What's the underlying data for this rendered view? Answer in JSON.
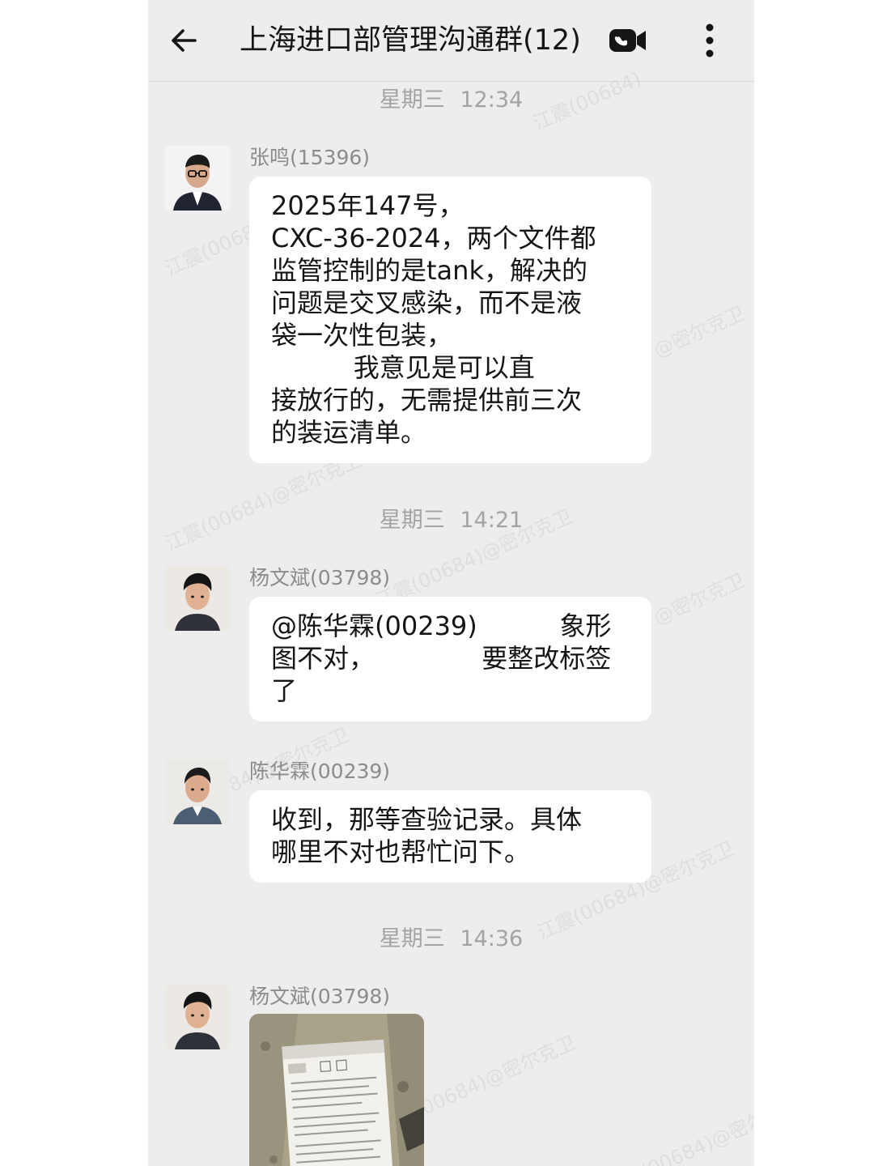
{
  "header": {
    "title": "上海进口部管理沟通群(12)",
    "back_icon": "arrow-left-icon",
    "video_icon": "video-call-icon",
    "more_icon": "more-vertical-icon"
  },
  "chat": {
    "time_1": "星期三 12:34",
    "time_2": "星期三 14:21",
    "time_3": "星期三 14:36",
    "messages": [
      {
        "sender": "张鸣(15396)",
        "lines": [
          "2025年147号，",
          "CXC-36-2024，两个文件都",
          "监管控制的是tank，解决的",
          "问题是交叉感染，而不是液",
          "袋一次性包装，",
          "          我意见是可以直",
          "接放行的，无需提供前三次",
          "的装运清单。"
        ]
      },
      {
        "sender": "杨文斌(03798)",
        "lines": [
          "@陈华霖(00239)          象形",
          "图不对，             要整改标签",
          "了"
        ]
      },
      {
        "sender": "陈华霖(00239)",
        "lines": [
          "收到，那等查验记录。具体",
          "哪里不对也帮忙问下。"
        ]
      },
      {
        "sender": "杨文斌(03798)",
        "image": "label-photo"
      }
    ]
  },
  "colors": {
    "chat_background": "#ededed",
    "bubble": "#ffffff",
    "meta_text": "#a3a3a3",
    "title_text": "#151515"
  }
}
